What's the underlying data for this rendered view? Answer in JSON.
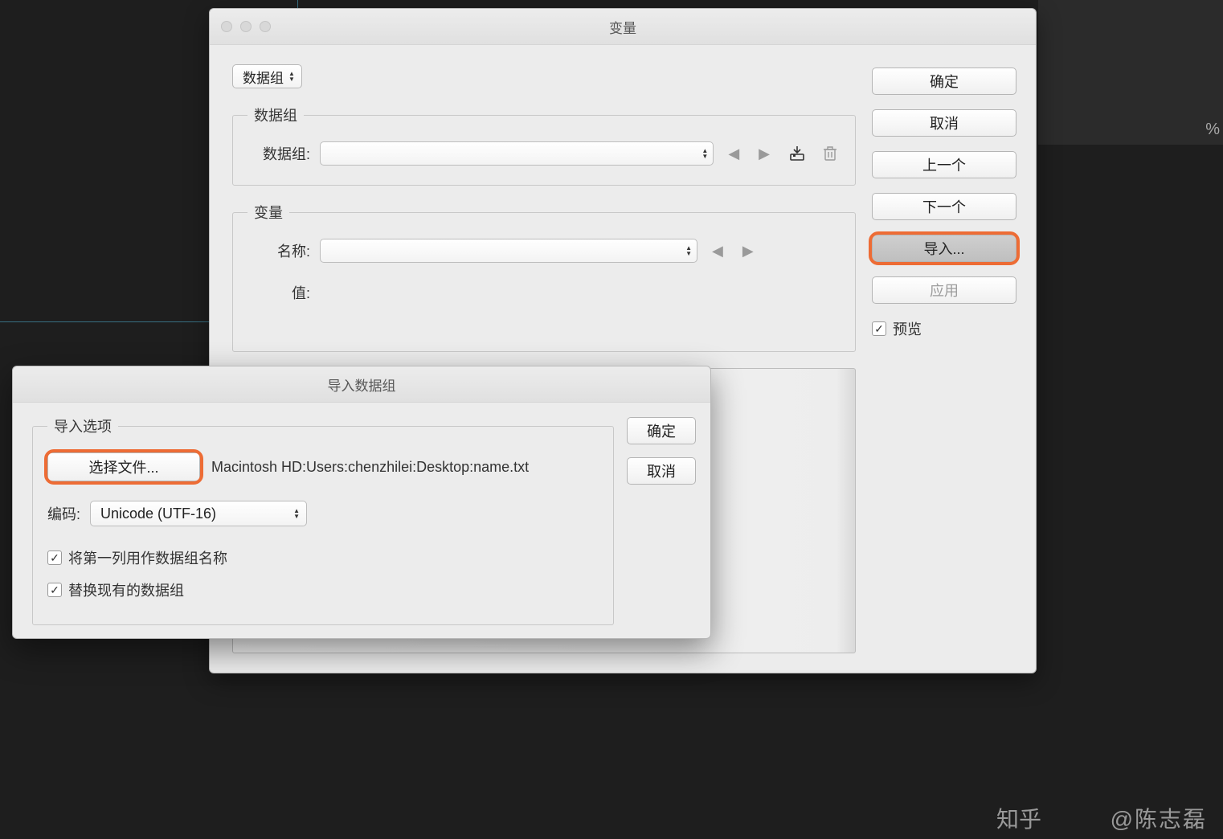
{
  "main_dialog": {
    "title": "变量",
    "view_dropdown": "数据组",
    "groups": {
      "dataset": {
        "legend": "数据组",
        "field_label": "数据组:"
      },
      "variable": {
        "legend": "变量",
        "name_label": "名称:",
        "value_label": "值:"
      }
    },
    "buttons": {
      "ok": "确定",
      "cancel": "取消",
      "prev": "上一个",
      "next": "下一个",
      "import": "导入...",
      "apply": "应用"
    },
    "preview_label": "预览"
  },
  "import_dialog": {
    "title": "导入数据组",
    "options_legend": "导入选项",
    "select_file_button": "选择文件...",
    "file_path": "Macintosh HD:Users:chenzhilei:Desktop:name.txt",
    "encoding_label": "编码:",
    "encoding_value": "Unicode (UTF-16)",
    "checkbox_first_col": "将第一列用作数据组名称",
    "checkbox_replace": "替换现有的数据组",
    "buttons": {
      "ok": "确定",
      "cancel": "取消"
    }
  },
  "background": {
    "percent_symbol": "%"
  },
  "watermark": {
    "logo": "知乎",
    "author": "@陈志磊"
  }
}
